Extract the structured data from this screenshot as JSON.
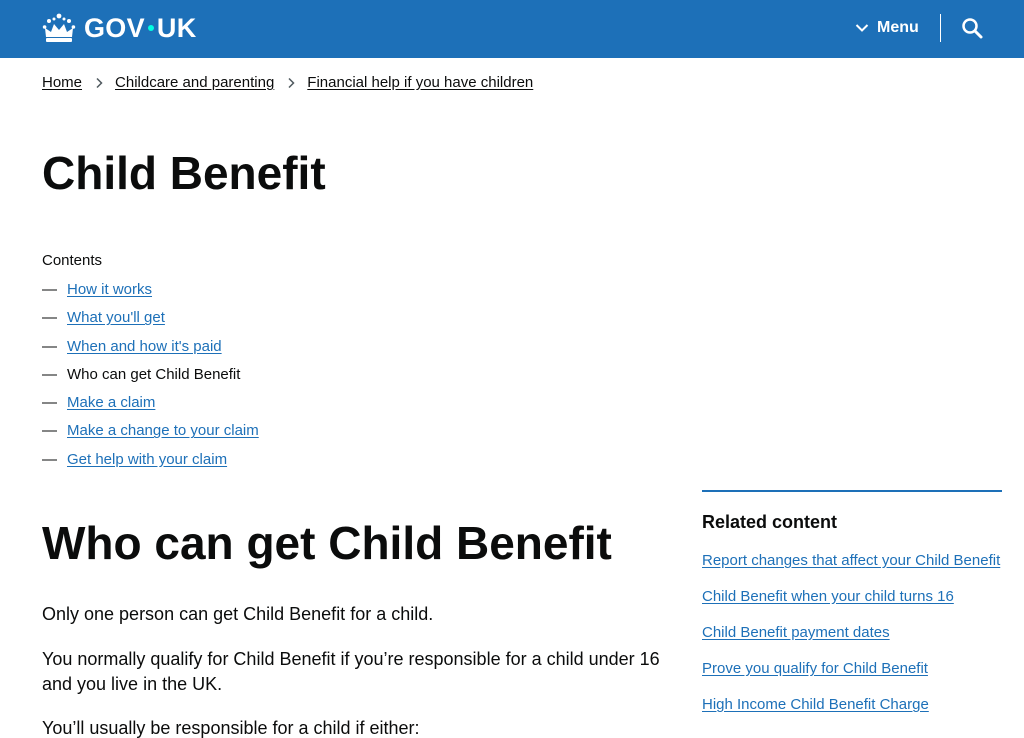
{
  "header": {
    "logo_text_left": "GOV",
    "logo_text_right": "UK",
    "menu_label": "Menu",
    "colors": {
      "brand": "#1d70b8",
      "dot": "#00ffe0",
      "link": "#1d70b8",
      "text": "#0b0c0c"
    }
  },
  "breadcrumb": [
    {
      "label": "Home"
    },
    {
      "label": "Childcare and parenting"
    },
    {
      "label": "Financial help if you have children"
    }
  ],
  "page_title": "Child Benefit",
  "contents": {
    "label": "Contents",
    "items": [
      {
        "label": "How it works",
        "current": false
      },
      {
        "label": "What you'll get",
        "current": false
      },
      {
        "label": "When and how it's paid",
        "current": false
      },
      {
        "label": "Who can get Child Benefit",
        "current": true
      },
      {
        "label": "Make a claim",
        "current": false
      },
      {
        "label": "Make a change to your claim",
        "current": false
      },
      {
        "label": "Get help with your claim",
        "current": false
      }
    ],
    "dash": "—"
  },
  "section": {
    "title": "Who can get Child Benefit",
    "paragraphs": [
      "Only one person can get Child Benefit for a child.",
      "You normally qualify for Child Benefit if you’re responsible for a child under 16 and you live in the UK.",
      "You’ll usually be responsible for a child if either:"
    ]
  },
  "related": {
    "title": "Related content",
    "links": [
      "Report changes that affect your Child Benefit",
      "Child Benefit when your child turns 16",
      "Child Benefit payment dates",
      "Prove you qualify for Child Benefit",
      "High Income Child Benefit Charge"
    ]
  },
  "icons": {
    "crown": "crown-icon",
    "menu_chevron": "chevron-down-icon",
    "search": "search-icon",
    "breadcrumb_separator": "chevron-right-icon"
  }
}
